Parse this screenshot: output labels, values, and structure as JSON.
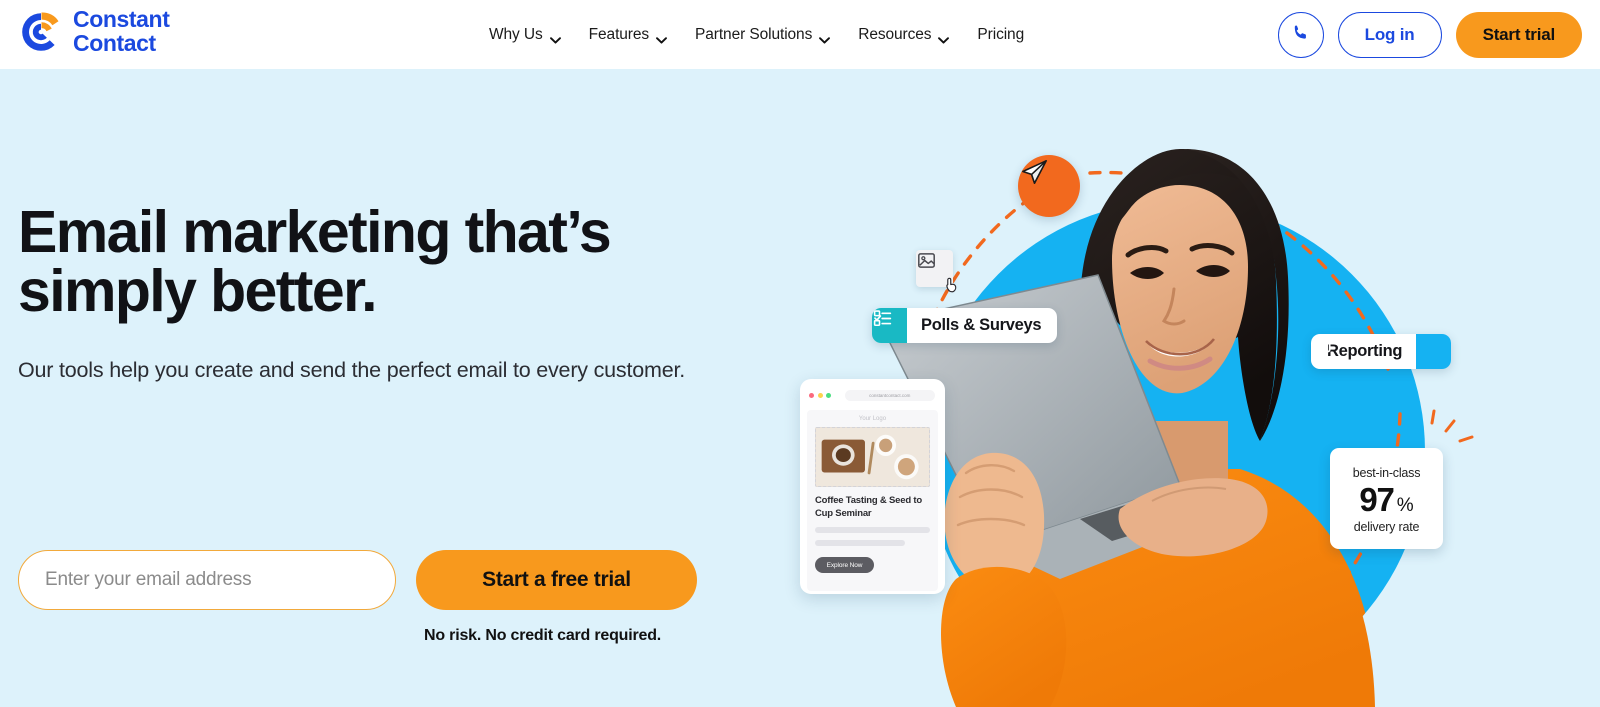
{
  "brand": {
    "name_line1": "Constant",
    "name_line2": "Contact",
    "logo_icon": "constant-contact-logo-icon",
    "blue": "#1b49df",
    "orange": "#f8991d"
  },
  "header": {
    "nav": [
      {
        "label": "Why Us",
        "has_dropdown": true,
        "icon": "chevron-down-icon"
      },
      {
        "label": "Features",
        "has_dropdown": true,
        "icon": "chevron-down-icon"
      },
      {
        "label": "Partner Solutions",
        "has_dropdown": true,
        "icon": "chevron-down-icon"
      },
      {
        "label": "Resources",
        "has_dropdown": true,
        "icon": "chevron-down-icon"
      },
      {
        "label": "Pricing",
        "has_dropdown": false,
        "icon": ""
      }
    ],
    "phone_icon": "phone-icon",
    "login_label": "Log in",
    "trial_label": "Start trial"
  },
  "hero": {
    "headline_line1": "Email marketing that’s",
    "headline_line2": "simply better.",
    "subhead": "Our tools help you create and send the perfect email to every customer.",
    "email_placeholder": "Enter your email address",
    "email_value": "",
    "cta_label": "Start a free trial",
    "disclaimer": "No risk. No credit card required.",
    "background_color": "#ddf2fb",
    "circle_color": "#15b2f2"
  },
  "art": {
    "plane_icon": "paper-plane-icon",
    "badges": [
      {
        "label": "Polls & Surveys",
        "icon": "checklist-icon",
        "icon_color": "#19b9c4"
      },
      {
        "label": "Reporting",
        "icon": "chart-report-icon",
        "icon_color": "#15b2f2"
      }
    ],
    "stat_card": {
      "top_label": "best-in-class",
      "value": "97",
      "unit": "%",
      "bottom_label": "delivery rate"
    },
    "email_mockup": {
      "url": "constantcontact.com",
      "logo_placeholder": "Your Logo",
      "title": "Coffee Tasting & Seed to Cup Seminar",
      "button_label": "Explore Now",
      "image_icon": "image-placeholder-icon",
      "cursor_icon": "cursor-hand-icon"
    }
  }
}
